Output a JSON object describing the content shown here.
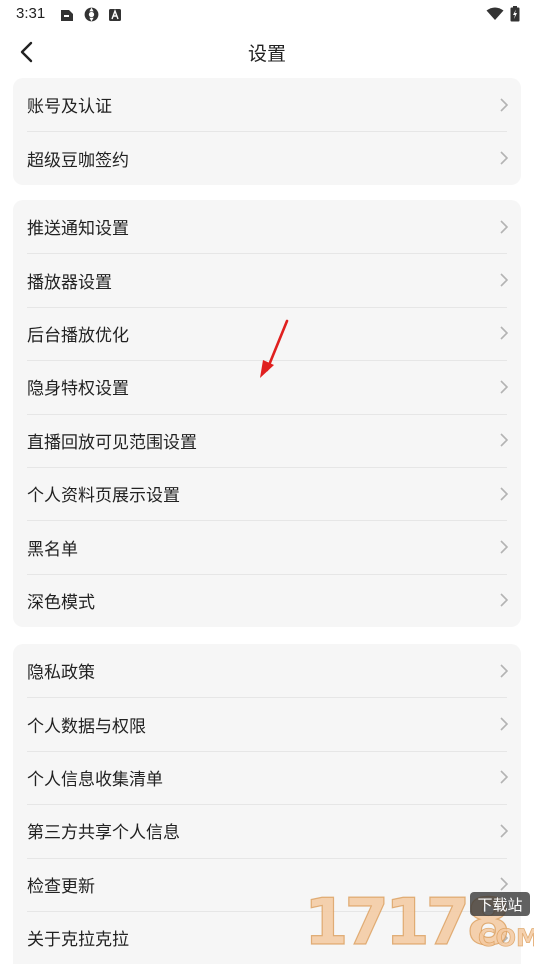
{
  "status_bar": {
    "time": "3:31",
    "left_icons": [
      "notification-app-icon",
      "sync-icon",
      "a-badge-icon"
    ],
    "right_icons": [
      "wifi-icon",
      "battery-charging-icon"
    ]
  },
  "header": {
    "title": "设置",
    "back_icon": "chevron-left-icon"
  },
  "groups": [
    {
      "items": [
        "账号及认证",
        "超级豆咖签约"
      ]
    },
    {
      "items": [
        "推送通知设置",
        "播放器设置",
        "后台播放优化",
        "隐身特权设置",
        "直播回放可见范围设置",
        "个人资料页展示设置",
        "黑名单",
        "深色模式"
      ]
    },
    {
      "items": [
        "隐私政策",
        "个人数据与权限",
        "个人信息收集清单",
        "第三方共享个人信息",
        "检查更新",
        "关于克拉克拉"
      ]
    }
  ],
  "annotation": {
    "arrow_color": "#e0201f"
  },
  "watermark": {
    "number": "17178",
    "badge": "下载站",
    "suffix": "COM"
  },
  "colors": {
    "group_bg": "#f6f6f6",
    "divider": "#e6e6e6",
    "chevron": "#b3b3b3"
  }
}
